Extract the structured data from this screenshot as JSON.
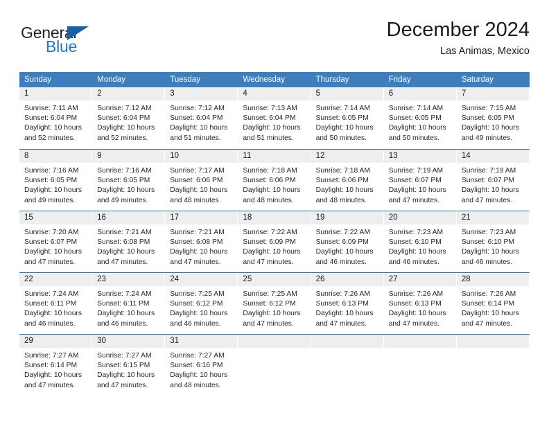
{
  "logo": {
    "word1": "General",
    "word2": "Blue",
    "triangle_color": "#1463a5",
    "word2_color": "#2077c0"
  },
  "header": {
    "title": "December 2024",
    "subtitle": "Las Animas, Mexico"
  },
  "theme": {
    "header_blue": "#3d7ebe",
    "separator_blue": "#2f6fae",
    "day_band_gray": "#eeeeee"
  },
  "weekdays": [
    "Sunday",
    "Monday",
    "Tuesday",
    "Wednesday",
    "Thursday",
    "Friday",
    "Saturday"
  ],
  "weeks": [
    [
      {
        "day": "1",
        "l1": "Sunrise: 7:11 AM",
        "l2": "Sunset: 6:04 PM",
        "l3": "Daylight: 10 hours",
        "l4": "and 52 minutes."
      },
      {
        "day": "2",
        "l1": "Sunrise: 7:12 AM",
        "l2": "Sunset: 6:04 PM",
        "l3": "Daylight: 10 hours",
        "l4": "and 52 minutes."
      },
      {
        "day": "3",
        "l1": "Sunrise: 7:12 AM",
        "l2": "Sunset: 6:04 PM",
        "l3": "Daylight: 10 hours",
        "l4": "and 51 minutes."
      },
      {
        "day": "4",
        "l1": "Sunrise: 7:13 AM",
        "l2": "Sunset: 6:04 PM",
        "l3": "Daylight: 10 hours",
        "l4": "and 51 minutes."
      },
      {
        "day": "5",
        "l1": "Sunrise: 7:14 AM",
        "l2": "Sunset: 6:05 PM",
        "l3": "Daylight: 10 hours",
        "l4": "and 50 minutes."
      },
      {
        "day": "6",
        "l1": "Sunrise: 7:14 AM",
        "l2": "Sunset: 6:05 PM",
        "l3": "Daylight: 10 hours",
        "l4": "and 50 minutes."
      },
      {
        "day": "7",
        "l1": "Sunrise: 7:15 AM",
        "l2": "Sunset: 6:05 PM",
        "l3": "Daylight: 10 hours",
        "l4": "and 49 minutes."
      }
    ],
    [
      {
        "day": "8",
        "l1": "Sunrise: 7:16 AM",
        "l2": "Sunset: 6:05 PM",
        "l3": "Daylight: 10 hours",
        "l4": "and 49 minutes."
      },
      {
        "day": "9",
        "l1": "Sunrise: 7:16 AM",
        "l2": "Sunset: 6:05 PM",
        "l3": "Daylight: 10 hours",
        "l4": "and 49 minutes."
      },
      {
        "day": "10",
        "l1": "Sunrise: 7:17 AM",
        "l2": "Sunset: 6:06 PM",
        "l3": "Daylight: 10 hours",
        "l4": "and 48 minutes."
      },
      {
        "day": "11",
        "l1": "Sunrise: 7:18 AM",
        "l2": "Sunset: 6:06 PM",
        "l3": "Daylight: 10 hours",
        "l4": "and 48 minutes."
      },
      {
        "day": "12",
        "l1": "Sunrise: 7:18 AM",
        "l2": "Sunset: 6:06 PM",
        "l3": "Daylight: 10 hours",
        "l4": "and 48 minutes."
      },
      {
        "day": "13",
        "l1": "Sunrise: 7:19 AM",
        "l2": "Sunset: 6:07 PM",
        "l3": "Daylight: 10 hours",
        "l4": "and 47 minutes."
      },
      {
        "day": "14",
        "l1": "Sunrise: 7:19 AM",
        "l2": "Sunset: 6:07 PM",
        "l3": "Daylight: 10 hours",
        "l4": "and 47 minutes."
      }
    ],
    [
      {
        "day": "15",
        "l1": "Sunrise: 7:20 AM",
        "l2": "Sunset: 6:07 PM",
        "l3": "Daylight: 10 hours",
        "l4": "and 47 minutes."
      },
      {
        "day": "16",
        "l1": "Sunrise: 7:21 AM",
        "l2": "Sunset: 6:08 PM",
        "l3": "Daylight: 10 hours",
        "l4": "and 47 minutes."
      },
      {
        "day": "17",
        "l1": "Sunrise: 7:21 AM",
        "l2": "Sunset: 6:08 PM",
        "l3": "Daylight: 10 hours",
        "l4": "and 47 minutes."
      },
      {
        "day": "18",
        "l1": "Sunrise: 7:22 AM",
        "l2": "Sunset: 6:09 PM",
        "l3": "Daylight: 10 hours",
        "l4": "and 47 minutes."
      },
      {
        "day": "19",
        "l1": "Sunrise: 7:22 AM",
        "l2": "Sunset: 6:09 PM",
        "l3": "Daylight: 10 hours",
        "l4": "and 46 minutes."
      },
      {
        "day": "20",
        "l1": "Sunrise: 7:23 AM",
        "l2": "Sunset: 6:10 PM",
        "l3": "Daylight: 10 hours",
        "l4": "and 46 minutes."
      },
      {
        "day": "21",
        "l1": "Sunrise: 7:23 AM",
        "l2": "Sunset: 6:10 PM",
        "l3": "Daylight: 10 hours",
        "l4": "and 46 minutes."
      }
    ],
    [
      {
        "day": "22",
        "l1": "Sunrise: 7:24 AM",
        "l2": "Sunset: 6:11 PM",
        "l3": "Daylight: 10 hours",
        "l4": "and 46 minutes."
      },
      {
        "day": "23",
        "l1": "Sunrise: 7:24 AM",
        "l2": "Sunset: 6:11 PM",
        "l3": "Daylight: 10 hours",
        "l4": "and 46 minutes."
      },
      {
        "day": "24",
        "l1": "Sunrise: 7:25 AM",
        "l2": "Sunset: 6:12 PM",
        "l3": "Daylight: 10 hours",
        "l4": "and 46 minutes."
      },
      {
        "day": "25",
        "l1": "Sunrise: 7:25 AM",
        "l2": "Sunset: 6:12 PM",
        "l3": "Daylight: 10 hours",
        "l4": "and 47 minutes."
      },
      {
        "day": "26",
        "l1": "Sunrise: 7:26 AM",
        "l2": "Sunset: 6:13 PM",
        "l3": "Daylight: 10 hours",
        "l4": "and 47 minutes."
      },
      {
        "day": "27",
        "l1": "Sunrise: 7:26 AM",
        "l2": "Sunset: 6:13 PM",
        "l3": "Daylight: 10 hours",
        "l4": "and 47 minutes."
      },
      {
        "day": "28",
        "l1": "Sunrise: 7:26 AM",
        "l2": "Sunset: 6:14 PM",
        "l3": "Daylight: 10 hours",
        "l4": "and 47 minutes."
      }
    ],
    [
      {
        "day": "29",
        "l1": "Sunrise: 7:27 AM",
        "l2": "Sunset: 6:14 PM",
        "l3": "Daylight: 10 hours",
        "l4": "and 47 minutes."
      },
      {
        "day": "30",
        "l1": "Sunrise: 7:27 AM",
        "l2": "Sunset: 6:15 PM",
        "l3": "Daylight: 10 hours",
        "l4": "and 47 minutes."
      },
      {
        "day": "31",
        "l1": "Sunrise: 7:27 AM",
        "l2": "Sunset: 6:16 PM",
        "l3": "Daylight: 10 hours",
        "l4": "and 48 minutes."
      },
      {
        "day": "",
        "l1": "",
        "l2": "",
        "l3": "",
        "l4": ""
      },
      {
        "day": "",
        "l1": "",
        "l2": "",
        "l3": "",
        "l4": ""
      },
      {
        "day": "",
        "l1": "",
        "l2": "",
        "l3": "",
        "l4": ""
      },
      {
        "day": "",
        "l1": "",
        "l2": "",
        "l3": "",
        "l4": ""
      }
    ]
  ]
}
